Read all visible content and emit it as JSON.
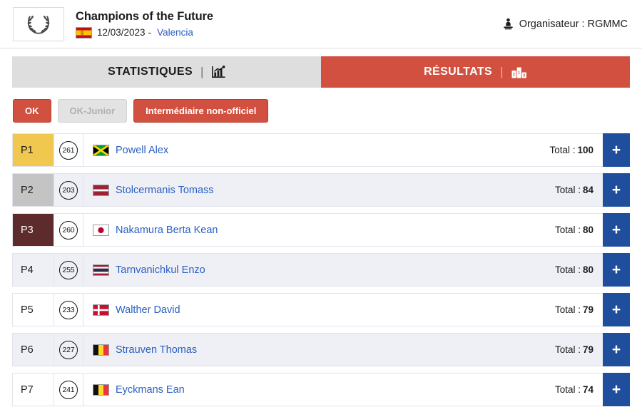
{
  "header": {
    "logo_icon": "laurel-wreath-icon",
    "event_title": "Champions of the Future",
    "country_flag": "flag-spain",
    "date": "12/03/2023",
    "separator": "-",
    "city": "Valencia",
    "organiser_icon": "trophy-icon",
    "organiser_label": "Organisateur : RGMMC"
  },
  "tabs": [
    {
      "label": "STATISTIQUES",
      "icon": "bar-chart-icon",
      "separator": "|",
      "active": false
    },
    {
      "label": "RÉSULTATS",
      "icon": "podium-icon",
      "separator": "|",
      "active": true
    }
  ],
  "categories": [
    {
      "label": "OK",
      "state": "active"
    },
    {
      "label": "OK-Junior",
      "state": "disabled"
    },
    {
      "label": "Intermédiaire non-officiel",
      "state": "alt"
    }
  ],
  "results": {
    "total_label": "Total :",
    "expand_label": "+",
    "rows": [
      {
        "position": "P1",
        "number": "261",
        "flag": "flag-jamaica",
        "name": "Powell Alex",
        "total": "100",
        "medal": "gold"
      },
      {
        "position": "P2",
        "number": "203",
        "flag": "flag-latvia",
        "name": "Stolcermanis Tomass",
        "total": "84",
        "medal": "silver"
      },
      {
        "position": "P3",
        "number": "260",
        "flag": "flag-japan",
        "name": "Nakamura Berta Kean",
        "total": "80",
        "medal": "bronze"
      },
      {
        "position": "P4",
        "number": "255",
        "flag": "flag-thailand",
        "name": "Tarnvanichkul Enzo",
        "total": "80",
        "medal": "none"
      },
      {
        "position": "P5",
        "number": "233",
        "flag": "flag-denmark",
        "name": "Walther David",
        "total": "79",
        "medal": "none"
      },
      {
        "position": "P6",
        "number": "227",
        "flag": "flag-belgium",
        "name": "Strauven Thomas",
        "total": "79",
        "medal": "none"
      },
      {
        "position": "P7",
        "number": "241",
        "flag": "flag-belgium",
        "name": "Eyckmans Ean",
        "total": "74",
        "medal": "none"
      }
    ]
  },
  "colors": {
    "accent_red": "#d1503f",
    "link_blue": "#2b5fc2",
    "plus_blue": "#1f4e9c",
    "gold": "#f1c84f",
    "silver": "#c4c4c4",
    "bronze": "#5d2b2b",
    "alt_row": "#eff0f6"
  }
}
